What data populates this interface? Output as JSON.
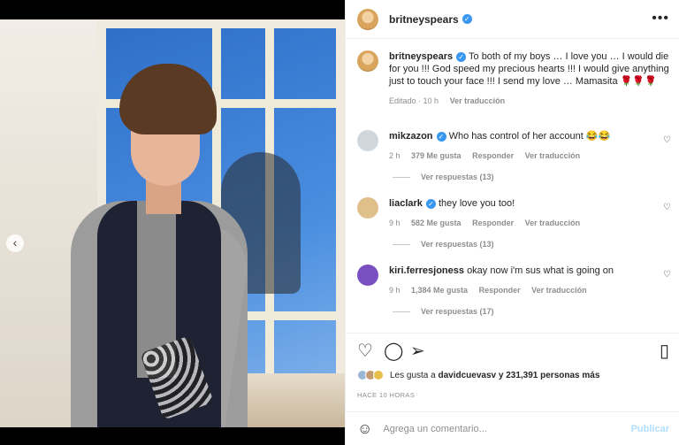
{
  "post": {
    "username": "britneyspears",
    "caption": "To both of my boys … I love you … I would die for you !!! God speed my precious hearts !!! I would give anything just to touch your face !!! I send my love … Mamasita 🌹🌹🌹",
    "edited": "Editado · 10 h",
    "see_translation": "Ver traducción"
  },
  "comments": [
    {
      "user": "mikzazon",
      "text": "Who has control of her account 😂😂",
      "time": "2 h",
      "likes": "379 Me gusta",
      "reply": "Responder",
      "translate": "Ver traducción",
      "replies": "Ver respuestas (13)",
      "avatar_color": "#cfd6dc"
    },
    {
      "user": "liaclark",
      "text": "they love you too!",
      "time": "9 h",
      "likes": "582 Me gusta",
      "reply": "Responder",
      "translate": "Ver traducción",
      "replies": "Ver respuestas (13)",
      "avatar_color": "#e0c08a"
    },
    {
      "user": "kiri.ferresjoness",
      "text": "okay now i'm sus what is going on",
      "time": "9 h",
      "likes": "1,384 Me gusta",
      "reply": "Responder",
      "translate": "Ver traducción",
      "replies": "Ver respuestas (17)",
      "avatar_color": "#7a4fbf"
    }
  ],
  "likes_text_prefix": "Les gusta a ",
  "likes_user": "davidcuevasv",
  "likes_text_suffix": " y 231,391 personas más",
  "timestamp": "HACE 10 HORAS",
  "add_comment_placeholder": "Agrega un comentario...",
  "publish_label": "Publicar",
  "icons": {
    "more": "more-horizontal-icon",
    "heart": "heart-icon",
    "comment": "comment-icon",
    "share": "send-icon",
    "save": "bookmark-icon",
    "emoji": "emoji-icon",
    "prev": "chevron-left-icon"
  },
  "colors": {
    "verified": "#3897f0",
    "publish": "#b2dffc",
    "muted": "#8e8e8e"
  },
  "carousel": {
    "slides": 2,
    "active": 2
  }
}
